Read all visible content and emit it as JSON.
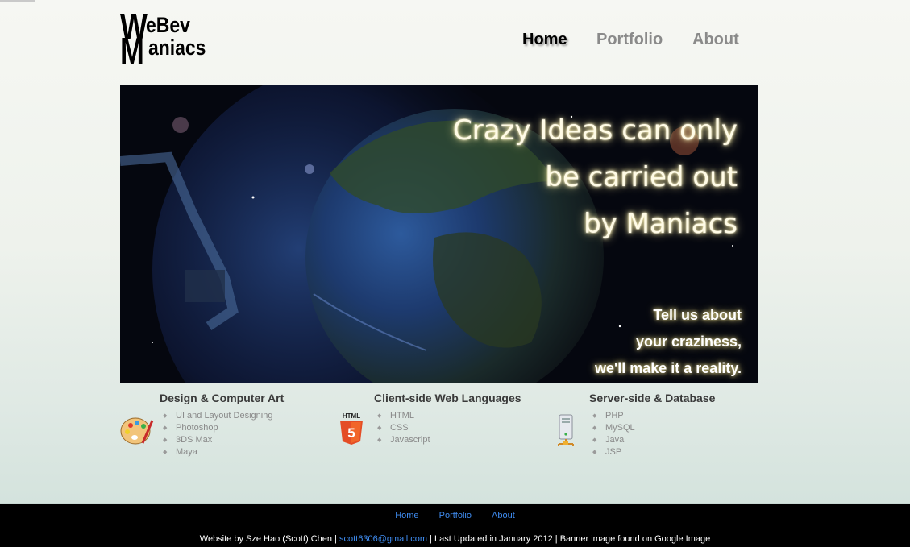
{
  "brand": {
    "line1_cap": "W",
    "line1_rest": "eBev",
    "line2_cap": "M",
    "line2_rest": "aniacs"
  },
  "nav": {
    "home": "Home",
    "portfolio": "Portfolio",
    "about": "About",
    "active": "Home"
  },
  "banner": {
    "headline": [
      "Crazy Ideas can only",
      "be carried out",
      "by Maniacs"
    ],
    "tagline": [
      "Tell us about",
      "your craziness,",
      "we'll make it a reality."
    ]
  },
  "skills": [
    {
      "title": "Design & Computer Art",
      "icon": "palette-icon",
      "items": [
        "UI and Layout Designing",
        "Photoshop",
        "3DS Max",
        "Maya"
      ]
    },
    {
      "title": "Client-side Web Languages",
      "icon": "html5-icon",
      "icon_text": "HTML",
      "items": [
        "HTML",
        "CSS",
        "Javascript"
      ]
    },
    {
      "title": "Server-side & Database",
      "icon": "server-icon",
      "items": [
        "PHP",
        "MySQL",
        "Java",
        "JSP"
      ]
    }
  ],
  "footer": {
    "links": [
      "Home",
      "Portfolio",
      "About"
    ],
    "credit_prefix": "Website by Sze Hao (Scott) Chen | ",
    "email": "scott6306@gmail.com",
    "credit_suffix": " | Last Updated in January 2012 | Banner image found on Google Image"
  },
  "colors": {
    "accent_link": "#3f8cf0",
    "html5_orange": "#e44d26",
    "footer_bg": "#000000"
  }
}
